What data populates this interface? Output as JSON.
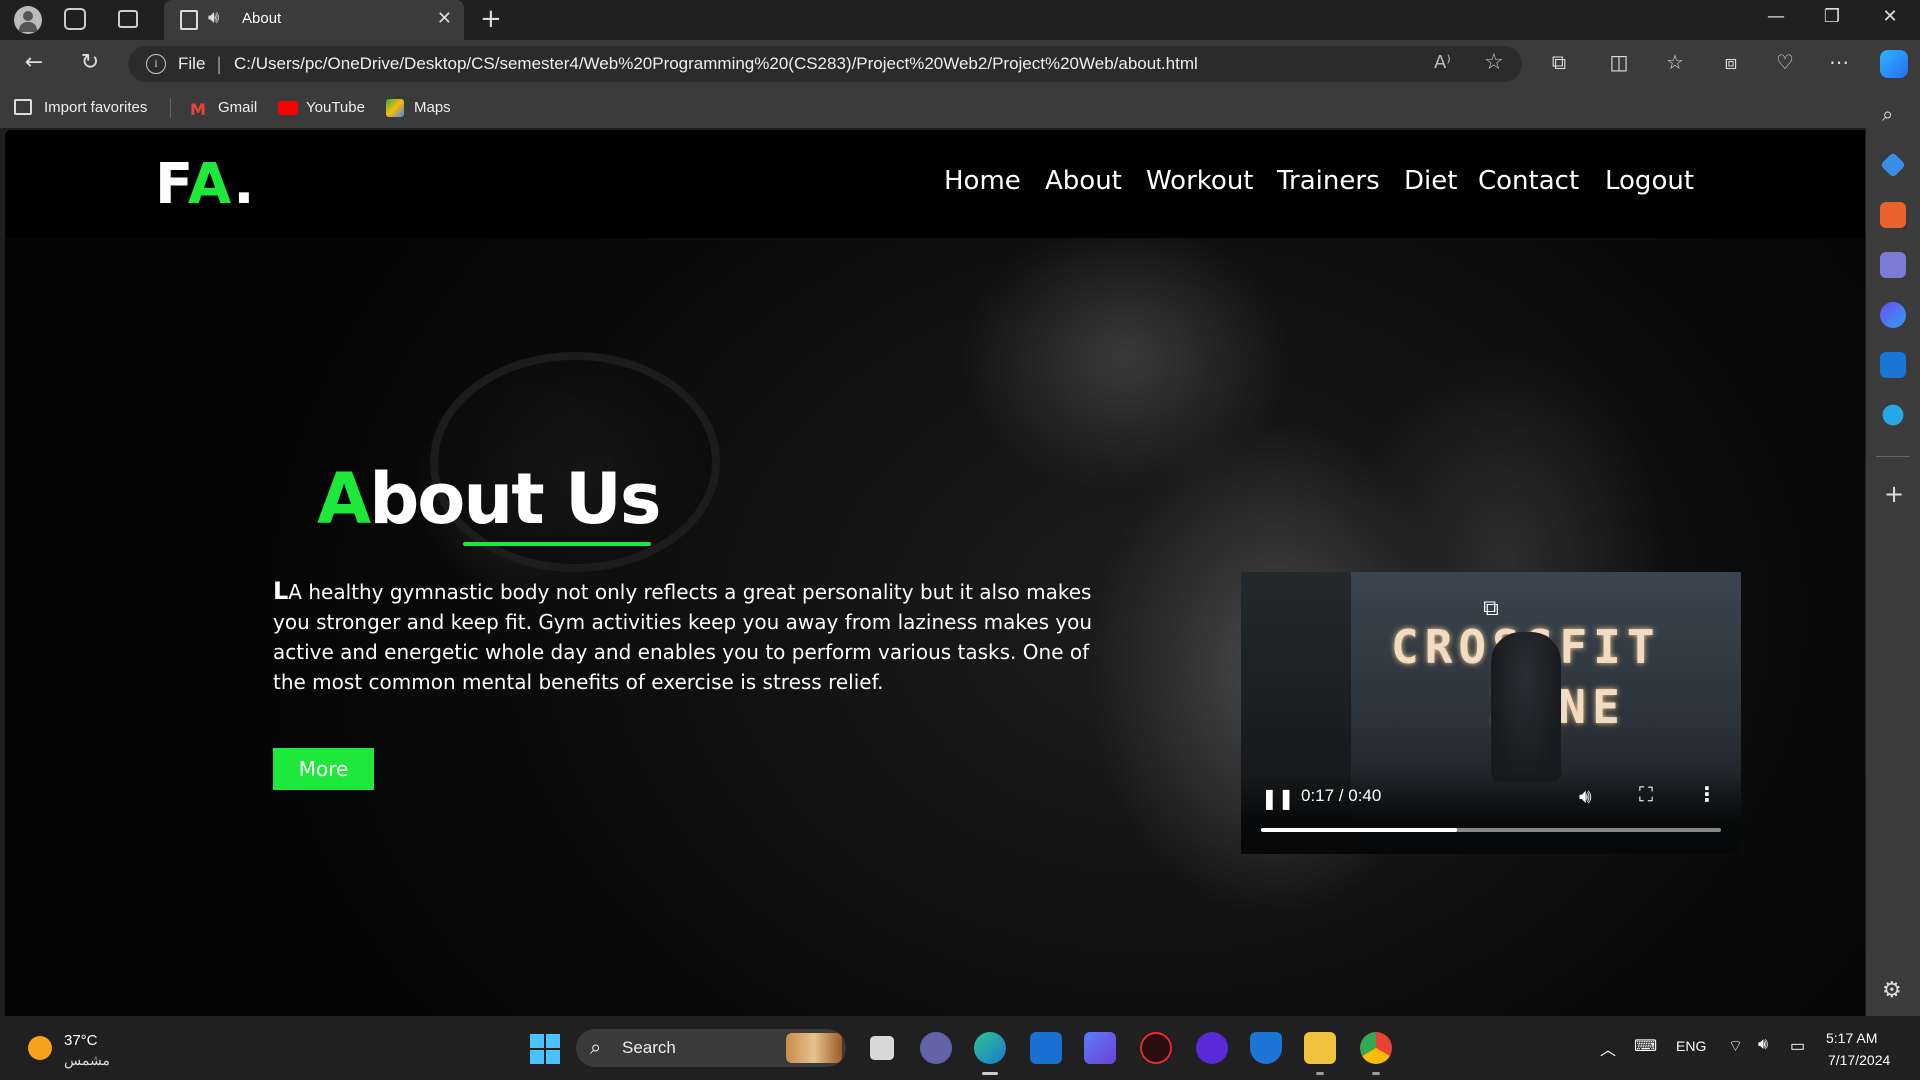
{
  "browser": {
    "tab_title": "About",
    "address": {
      "scheme_label": "File",
      "url": "C:/Users/pc/OneDrive/Desktop/CS/semester4/Web%20Programming%20(CS283)/Project%20Web2/Project%20Web/about.html"
    },
    "favorites": [
      {
        "label": "Import favorites",
        "icon": "import-icon"
      },
      {
        "label": "Gmail",
        "icon": "gmail-icon"
      },
      {
        "label": "YouTube",
        "icon": "youtube-icon"
      },
      {
        "label": "Maps",
        "icon": "maps-icon"
      }
    ]
  },
  "site": {
    "logo": {
      "part1": "F",
      "accent": "A",
      "part2": "."
    },
    "nav": [
      "Home",
      "About",
      "Workout",
      "Trainers",
      "Diet",
      "Contact",
      "Logout"
    ],
    "hero": {
      "title_accent": "A",
      "title_rest": "bout Us",
      "dropcap": "L",
      "text": "A healthy gymnastic body not only reflects a great personality but it also makes you stronger and keep fit. Gym activities keep you away from laziness makes you active and energetic whole day and enables you to perform various tasks. One of the most common mental benefits of exercise is stress relief.",
      "button": "More"
    },
    "video": {
      "sign_line1": "CROSSFIT",
      "sign_line2": "ZONE",
      "time": "0:17 / 0:40",
      "progress": 0.425
    },
    "colors": {
      "accent": "#1ee83a",
      "background": "#000000"
    }
  },
  "taskbar": {
    "weather": {
      "temp": "37°C",
      "condition": "مشمس"
    },
    "search_label": "Search",
    "language": "ENG",
    "time": "5:17 AM",
    "date": "7/17/2024"
  }
}
